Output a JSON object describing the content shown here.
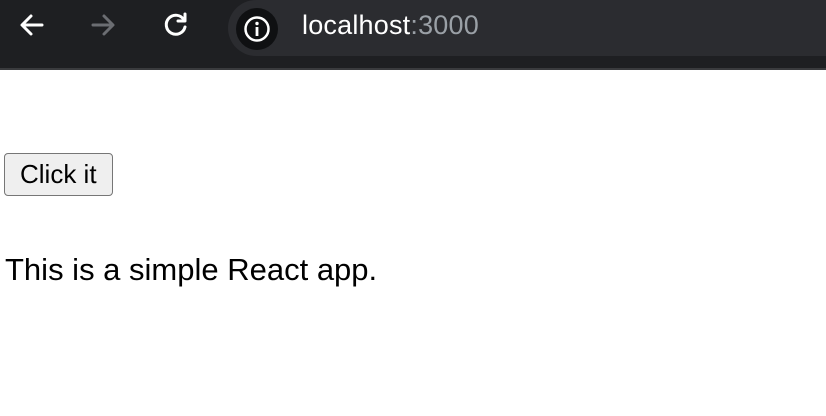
{
  "browser": {
    "url_host": "localhost",
    "url_port": ":3000",
    "icons": {
      "back": "arrow-left-icon",
      "forward": "arrow-right-icon",
      "reload": "reload-icon",
      "site_info": "info-icon"
    },
    "colors": {
      "toolbar_bg": "#1e1f22",
      "omnibox_bg": "#2b2c30",
      "url_host": "#ffffff",
      "url_port": "#9aa0a6",
      "forward_disabled": "#6b6d72"
    }
  },
  "page": {
    "button_label": "Click it",
    "text": "This is a simple React app."
  }
}
